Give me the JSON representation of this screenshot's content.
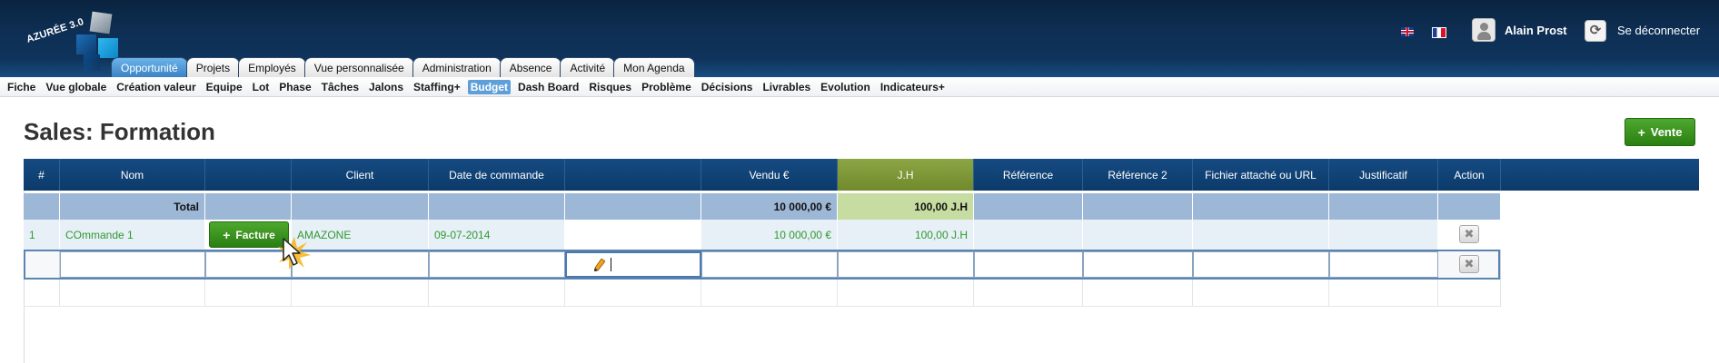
{
  "app": {
    "logo_text": "AZURÉE 3.0",
    "user_name": "Alain Prost",
    "logout_label": "Se déconnecter"
  },
  "tabs": [
    {
      "label": "Opportunité",
      "active": true
    },
    {
      "label": "Projets"
    },
    {
      "label": "Employés"
    },
    {
      "label": "Vue personnalisée"
    },
    {
      "label": "Administration"
    },
    {
      "label": "Absence"
    },
    {
      "label": "Activité"
    },
    {
      "label": "Mon Agenda"
    }
  ],
  "subnav": [
    {
      "label": "Fiche"
    },
    {
      "label": "Vue globale"
    },
    {
      "label": "Création valeur"
    },
    {
      "label": "Equipe"
    },
    {
      "label": "Lot"
    },
    {
      "label": "Phase"
    },
    {
      "label": "Tâches"
    },
    {
      "label": "Jalons"
    },
    {
      "label": "Staffing+"
    },
    {
      "label": "Budget",
      "active": true
    },
    {
      "label": "Dash Board"
    },
    {
      "label": "Risques"
    },
    {
      "label": "Problème"
    },
    {
      "label": "Décisions"
    },
    {
      "label": "Livrables"
    },
    {
      "label": "Evolution"
    },
    {
      "label": "Indicateurs+"
    }
  ],
  "page": {
    "title": "Sales: Formation",
    "vente_label": "Vente"
  },
  "table": {
    "headers": [
      "#",
      "Nom",
      "",
      "Client",
      "Date de commande",
      "",
      "Vendu €",
      "J.H",
      "Référence",
      "Référence 2",
      "Fichier attaché ou URL",
      "Justificatif",
      "Action"
    ],
    "total": {
      "label": "Total",
      "vendu": "10 000,00 €",
      "jh": "100,00 J.H"
    },
    "rows": [
      {
        "num": "1",
        "nom": "COmmande 1",
        "facture_label": "Facture",
        "client": "AMAZONE",
        "date": "09-07-2014",
        "vendu": "10 000,00 €",
        "jh": "100,00 J.H"
      }
    ],
    "delete_glyph": "✖"
  },
  "icons": {
    "plus": "+",
    "logout": "⟳"
  },
  "colors": {
    "header_blue": "#0c3a6a",
    "jh_green": "#708a2c",
    "button_green": "#2a7f12",
    "row_text_green": "#2f9a2f",
    "active_tab": "#3b84c6"
  }
}
